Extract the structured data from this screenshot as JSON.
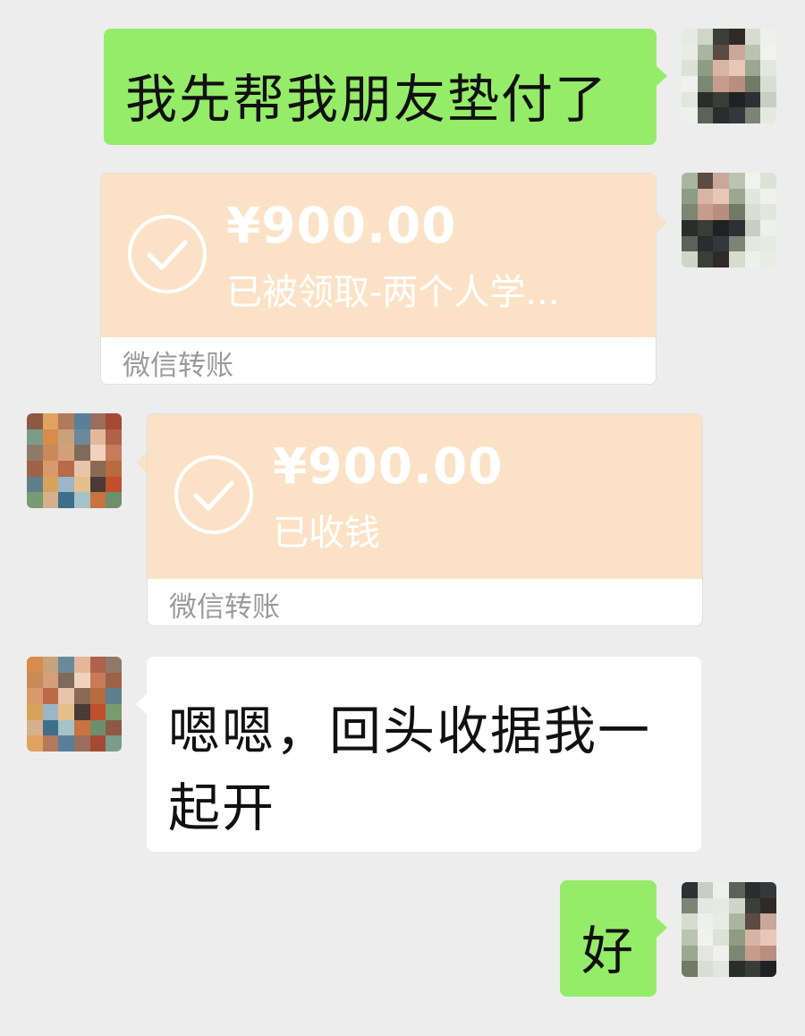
{
  "messages": [
    {
      "side": "right",
      "type": "text",
      "text": "我先帮我朋友垫付了"
    },
    {
      "side": "right",
      "type": "transfer",
      "amount": "¥900.00",
      "status": "已被领取-两个人学...",
      "footer": "微信转账"
    },
    {
      "side": "left",
      "type": "transfer",
      "amount": "¥900.00",
      "status": "已收钱",
      "footer": "微信转账"
    },
    {
      "side": "left",
      "type": "text",
      "line1": "嗯嗯，回头收据我一",
      "line2": "起开"
    },
    {
      "side": "right",
      "type": "text",
      "text": "好"
    }
  ],
  "colors": {
    "background": "#EDEDED",
    "outgoing_bubble": "#95EC69",
    "incoming_bubble": "#FFFFFF",
    "transfer_card": "#FBE2C6",
    "footer_text": "#9A9A9A"
  },
  "icons": {
    "transfer_status": "check-circle-icon"
  }
}
